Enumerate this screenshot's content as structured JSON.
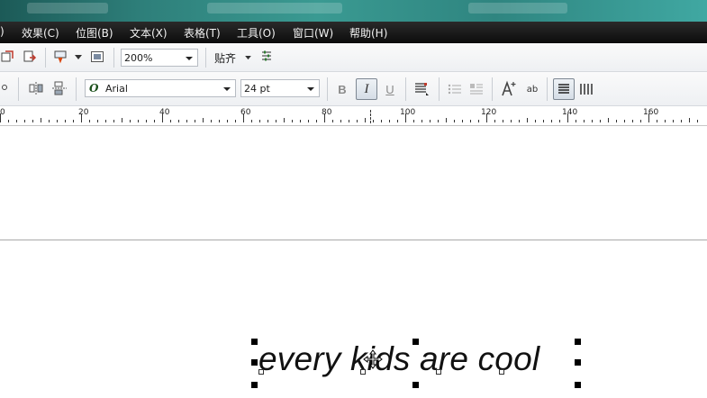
{
  "menu": {
    "items": [
      {
        "label": ")"
      },
      {
        "label": "效果(C)"
      },
      {
        "label": "位图(B)"
      },
      {
        "label": "文本(X)"
      },
      {
        "label": "表格(T)"
      },
      {
        "label": "工具(O)"
      },
      {
        "label": "窗口(W)"
      },
      {
        "label": "帮助(H)"
      }
    ]
  },
  "toolbar1": {
    "zoom": "200%",
    "snap_label": "贴齐"
  },
  "toolbar2": {
    "font_name": "Arial",
    "font_size": "24 pt",
    "bold_label": "B",
    "italic_label": "I",
    "underline_label": "U",
    "text_style_label": "ab"
  },
  "ruler": {
    "labels": [
      "0",
      "20",
      "40",
      "60",
      "80",
      "100",
      "120",
      "140",
      "160"
    ]
  },
  "canvas": {
    "text": "every kids are cool"
  }
}
